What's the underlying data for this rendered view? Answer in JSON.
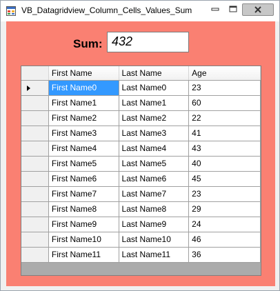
{
  "window": {
    "title": "VB_Datagridview_Column_Cells_Values_Sum"
  },
  "form": {
    "sum_label": "Sum:",
    "sum_value": "432"
  },
  "grid": {
    "columns": [
      "First Name",
      "Last Name",
      "Age"
    ],
    "rows": [
      [
        "First Name0",
        "Last Name0",
        "23"
      ],
      [
        "First Name1",
        "Last Name1",
        "60"
      ],
      [
        "First Name2",
        "Last Name2",
        "22"
      ],
      [
        "First Name3",
        "Last Name3",
        "41"
      ],
      [
        "First Name4",
        "Last Name4",
        "43"
      ],
      [
        "First Name5",
        "Last Name5",
        "40"
      ],
      [
        "First Name6",
        "Last Name6",
        "45"
      ],
      [
        "First Name7",
        "Last Name7",
        "23"
      ],
      [
        "First Name8",
        "Last Name8",
        "29"
      ],
      [
        "First Name9",
        "Last Name9",
        "24"
      ],
      [
        "First Name10",
        "Last Name10",
        "46"
      ],
      [
        "First Name11",
        "Last Name11",
        "36"
      ]
    ],
    "current_row_index": 0,
    "selected_cell": {
      "row": 0,
      "column": 0
    },
    "selection_color": "#3399ff"
  },
  "colors": {
    "form_background": "#fa8072",
    "grid_background": "#ababab"
  },
  "icons": {
    "app_icon": "windows-form-icon",
    "minimize": "minimize-icon",
    "maximize": "maximize-icon",
    "close": "close-icon",
    "current_row": "row-pointer-icon"
  }
}
